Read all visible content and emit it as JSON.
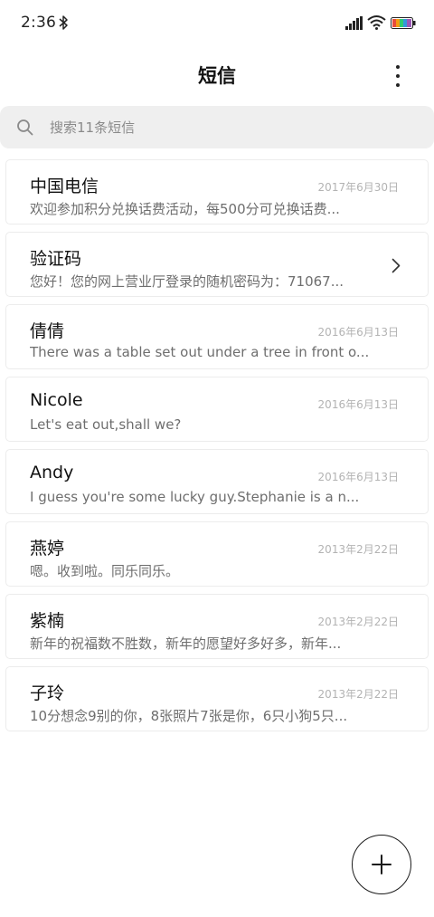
{
  "status_bar": {
    "time": "2:36",
    "icons": [
      "bluetooth-icon",
      "signal-icon",
      "wifi-icon",
      "battery-icon"
    ]
  },
  "header": {
    "title": "短信",
    "more_icon": "more-vertical-icon"
  },
  "search": {
    "placeholder": "搜索11条短信",
    "icon": "search-icon"
  },
  "conversations": [
    {
      "name": "中国电信",
      "date": "2017年6月30日",
      "preview": "欢迎参加积分兑换话费活动，每500分可兑换话费..."
    },
    {
      "name": "验证码",
      "date": "",
      "preview": "您好！您的网上营业厅登录的随机密码为：71067...",
      "has_chevron": true
    },
    {
      "name": "倩倩",
      "date": "2016年6月13日",
      "preview": "There was a table set out under a tree in front o..."
    },
    {
      "name": "Nicole",
      "date": "2016年6月13日",
      "preview": "Let's eat out,shall we?"
    },
    {
      "name": "Andy",
      "date": "2016年6月13日",
      "preview": "I guess you're some lucky guy.Stephanie is a n..."
    },
    {
      "name": "燕婷",
      "date": "2013年2月22日",
      "preview": "嗯。收到啦。同乐同乐。"
    },
    {
      "name": "紫楠",
      "date": "2013年2月22日",
      "preview": "新年的祝福数不胜数，新年的愿望好多好多，新年..."
    },
    {
      "name": "子玲",
      "date": "2013年2月22日",
      "preview": "10分想念9别的你，8张照片7张是你，6只小狗5只..."
    }
  ],
  "fab": {
    "icon": "plus-icon"
  },
  "colors": {
    "background": "#ffffff",
    "search_bg": "#efefef",
    "date_text": "#b3b3b3",
    "preview_text": "#6e6e6e"
  }
}
